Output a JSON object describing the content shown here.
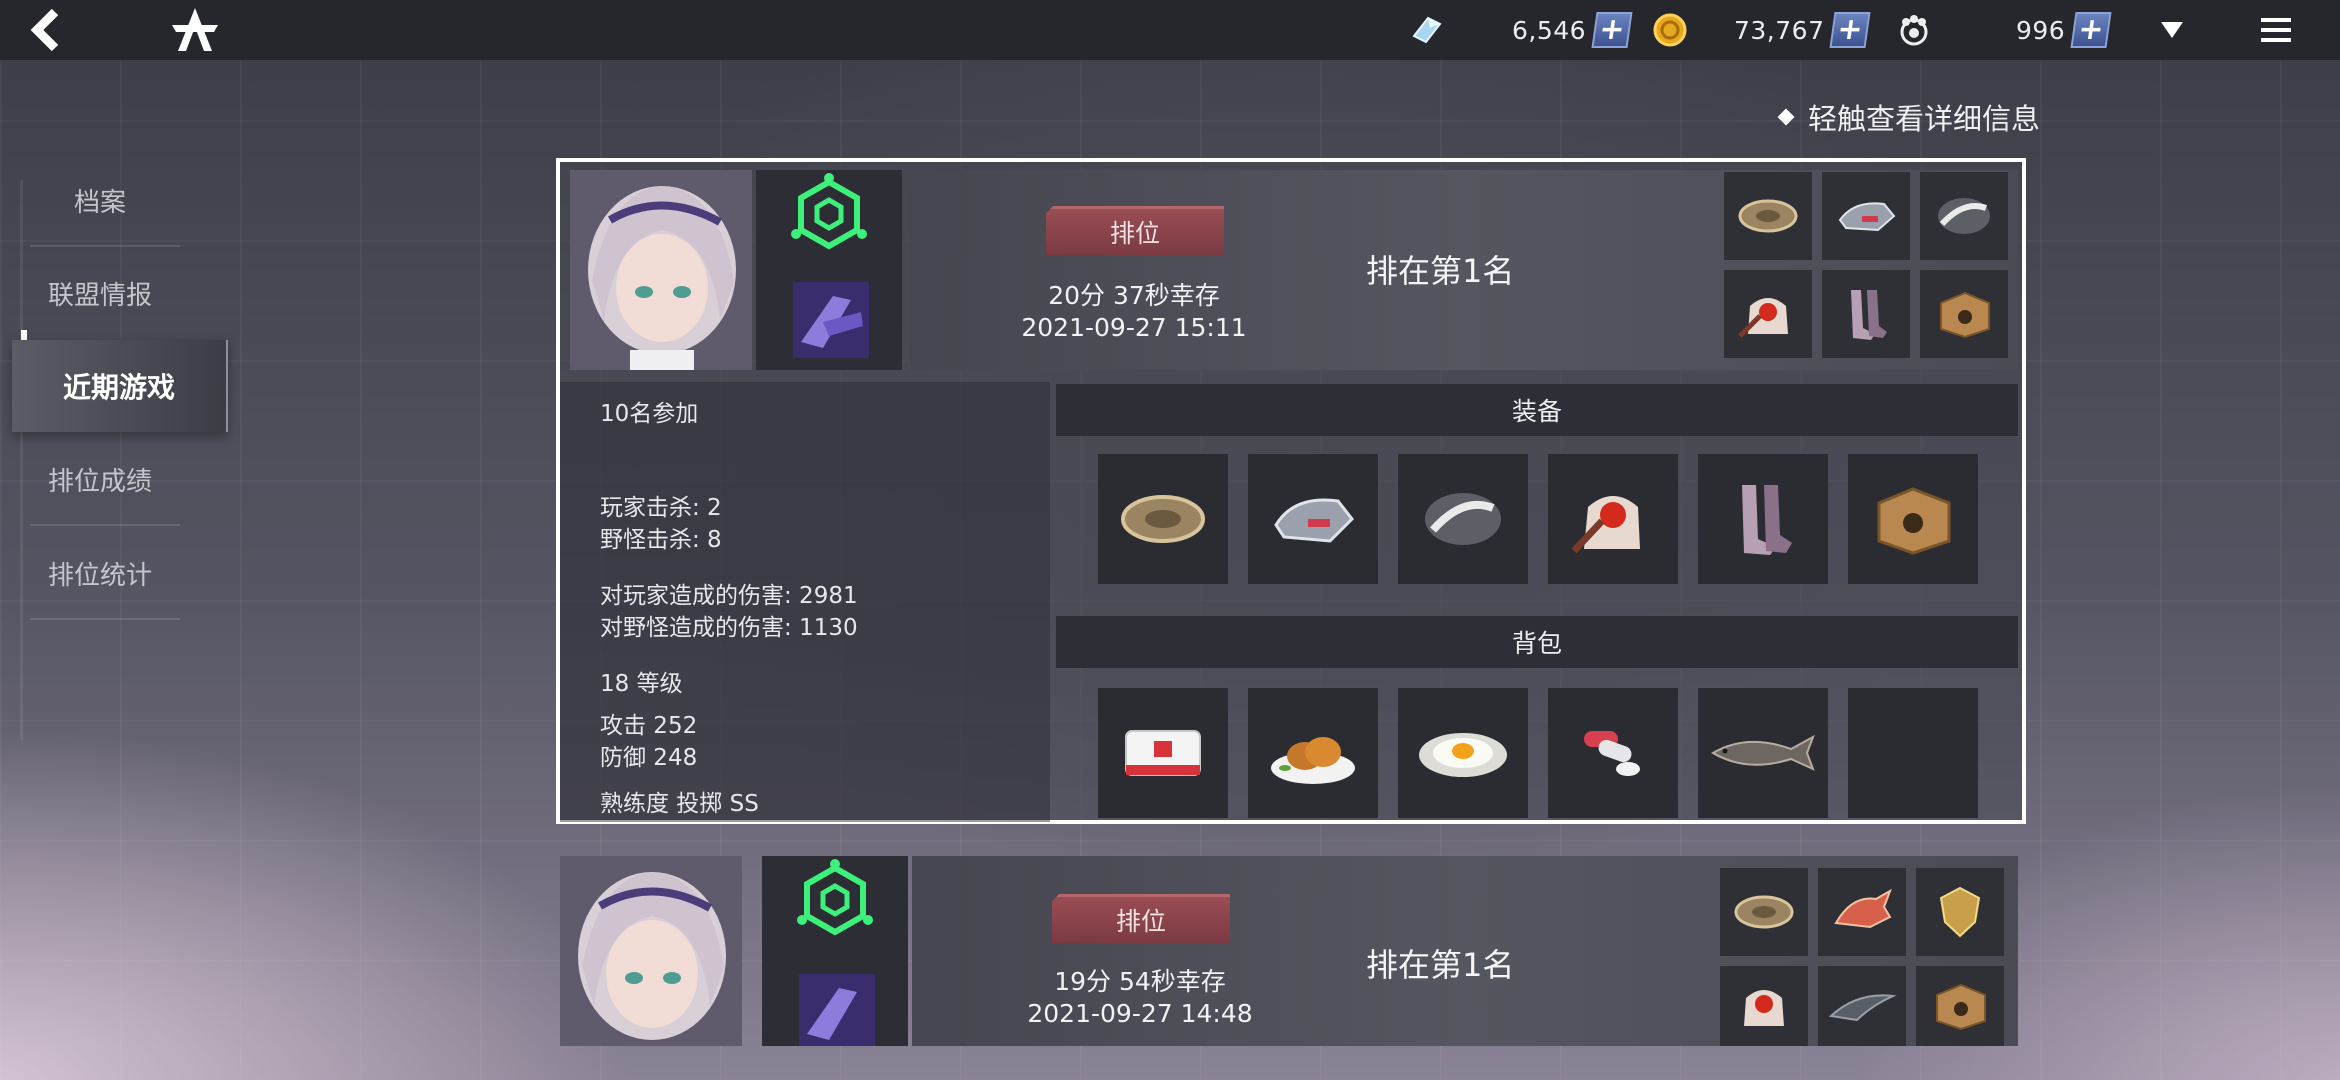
{
  "topbar": {
    "currencies": [
      {
        "icon": "crystal-icon",
        "value": "6,546"
      },
      {
        "icon": "gold-coin-icon",
        "value": "73,767"
      },
      {
        "icon": "paw-token-icon",
        "value": "996"
      }
    ],
    "plus": "+"
  },
  "sidebar": {
    "items": [
      {
        "label": "档案"
      },
      {
        "label": "联盟情报"
      },
      {
        "label": "近期游戏"
      },
      {
        "label": "排位成绩"
      },
      {
        "label": "排位统计"
      }
    ],
    "active_index": 2
  },
  "hint": "轻触查看详细信息",
  "games": [
    {
      "mode": "排位",
      "survival": "20分 37秒幸存",
      "datetime": "2021-09-27 15:11",
      "placement": "排在第1名",
      "participants": "10名参加",
      "player_kills": "玩家击杀: 2",
      "monster_kills": "野怪击杀: 8",
      "player_damage": "对玩家造成的伤害: 2981",
      "monster_damage": "对野怪造成的伤害: 1130",
      "level": "18 等级",
      "attack": "攻击 252",
      "defense": "防御 248",
      "mastery": "熟练度  投掷 SS",
      "equipment_title": "装备",
      "backpack_title": "背包",
      "equipment": [
        "bronze-disc-icon",
        "armored-gauntlet-icon",
        "steel-disc-icon",
        "red-chest-armor-icon",
        "boots-icon",
        "supply-crate-icon"
      ],
      "backpack": [
        "first-aid-kit-icon",
        "fried-chicken-icon",
        "fried-egg-icon",
        "pills-icon",
        "fish-icon",
        "empty-slot"
      ]
    },
    {
      "mode": "排位",
      "survival": "19分 54秒幸存",
      "datetime": "2021-09-27 14:48",
      "placement": "排在第1名",
      "equipment": [
        "bronze-disc-icon",
        "winged-helmet-icon",
        "golden-shield-icon",
        "red-chest-armor-icon",
        "chain-icon",
        "supply-crate-icon"
      ]
    }
  ],
  "colors": {
    "topbar": "#26272d",
    "rank_tag": "#8a424a",
    "emblem": "#3df07a",
    "selection_border": "#ffffff"
  }
}
